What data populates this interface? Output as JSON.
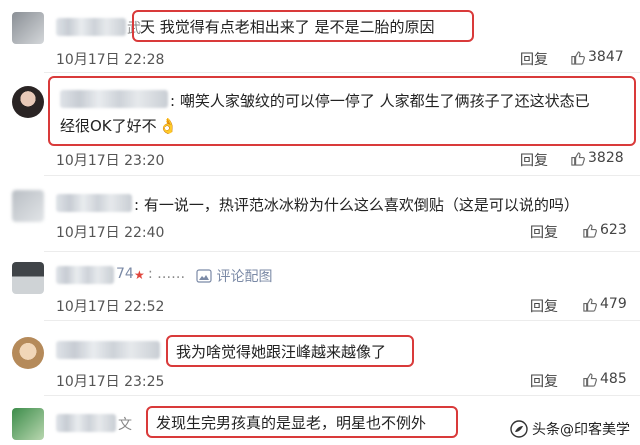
{
  "comments": [
    {
      "text": "天 我觉得有点老相出来了 是不是二胎的原因",
      "name_tail": "武",
      "time": "10月17日 22:28",
      "reply": "回复",
      "likes": "3847"
    },
    {
      "text": ": 嘲笑人家皱纹的可以停一停了 人家都生了俩孩子了还这状态已",
      "text2": "经很OK了好不",
      "emoji": "👌",
      "time": "10月17日 23:20",
      "reply": "回复",
      "likes": "3828"
    },
    {
      "text": ": 有一说一，热评范冰冰粉为什么这么喜欢倒贴（这是可以说的吗）",
      "time": "10月17日 22:40",
      "reply": "回复",
      "likes": "623"
    },
    {
      "text": "评论配图",
      "name_tail": "74",
      "time": "10月17日 22:52",
      "reply": "回复",
      "likes": "479"
    },
    {
      "text": "我为啥觉得她跟汪峰越来越像了",
      "time": "10月17日 23:25",
      "reply": "回复",
      "likes": "485"
    },
    {
      "text": "发现生完男孩真的是显老，明星也不例外",
      "name_tail": "文",
      "time": "",
      "reply": "",
      "likes": ""
    }
  ],
  "watermark": "头条@印客美学",
  "colors": {
    "highlight_box": "#d93a3a",
    "star": "#e0453c"
  }
}
